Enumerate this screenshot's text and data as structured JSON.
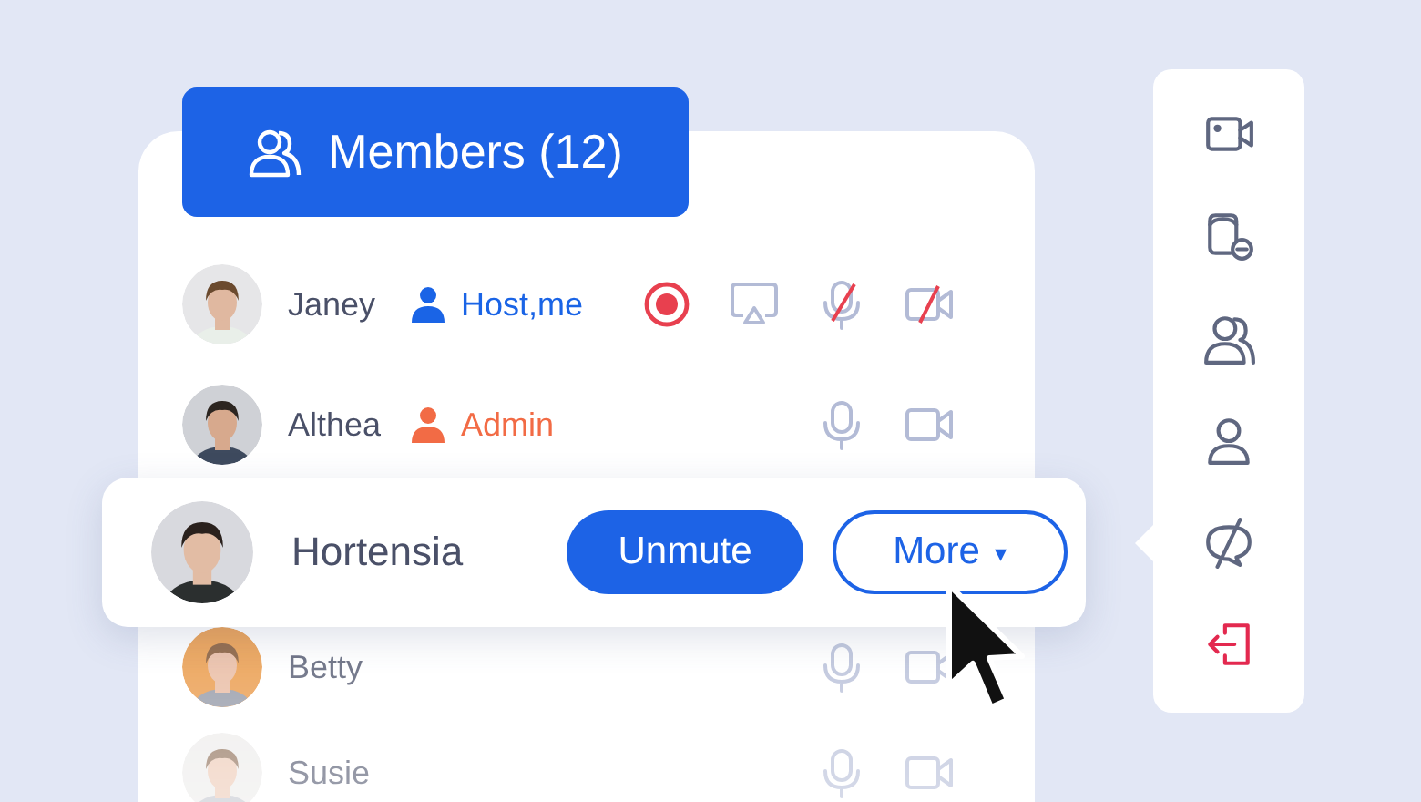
{
  "panel": {
    "title": "Members (12)"
  },
  "members": [
    {
      "kind": "row",
      "name": "Janey",
      "role": {
        "label": "Host,me",
        "color": "#1a64e6"
      },
      "recording": true,
      "screen_share": true,
      "mic_muted": true,
      "camera_off": true
    },
    {
      "kind": "row",
      "name": "Althea",
      "role": {
        "label": "Admin",
        "color": "#f26b45"
      },
      "mic_muted": false,
      "camera_off": false
    },
    {
      "kind": "focused",
      "name": "Hortensia",
      "actions": [
        {
          "label": "Unmute",
          "kind": "primary"
        },
        {
          "label": "More",
          "kind": "menu",
          "caret": "▾"
        }
      ]
    },
    {
      "kind": "row",
      "name": "Betty",
      "mic_muted": false,
      "camera_off": false
    },
    {
      "kind": "row",
      "name": "Susie",
      "mic_muted": false,
      "camera_off": false
    }
  ],
  "toolbar": {
    "items": [
      {
        "kind": "video"
      },
      {
        "kind": "stop-share"
      },
      {
        "kind": "members"
      },
      {
        "kind": "profile"
      },
      {
        "kind": "chat-off"
      },
      {
        "kind": "leave"
      }
    ]
  }
}
